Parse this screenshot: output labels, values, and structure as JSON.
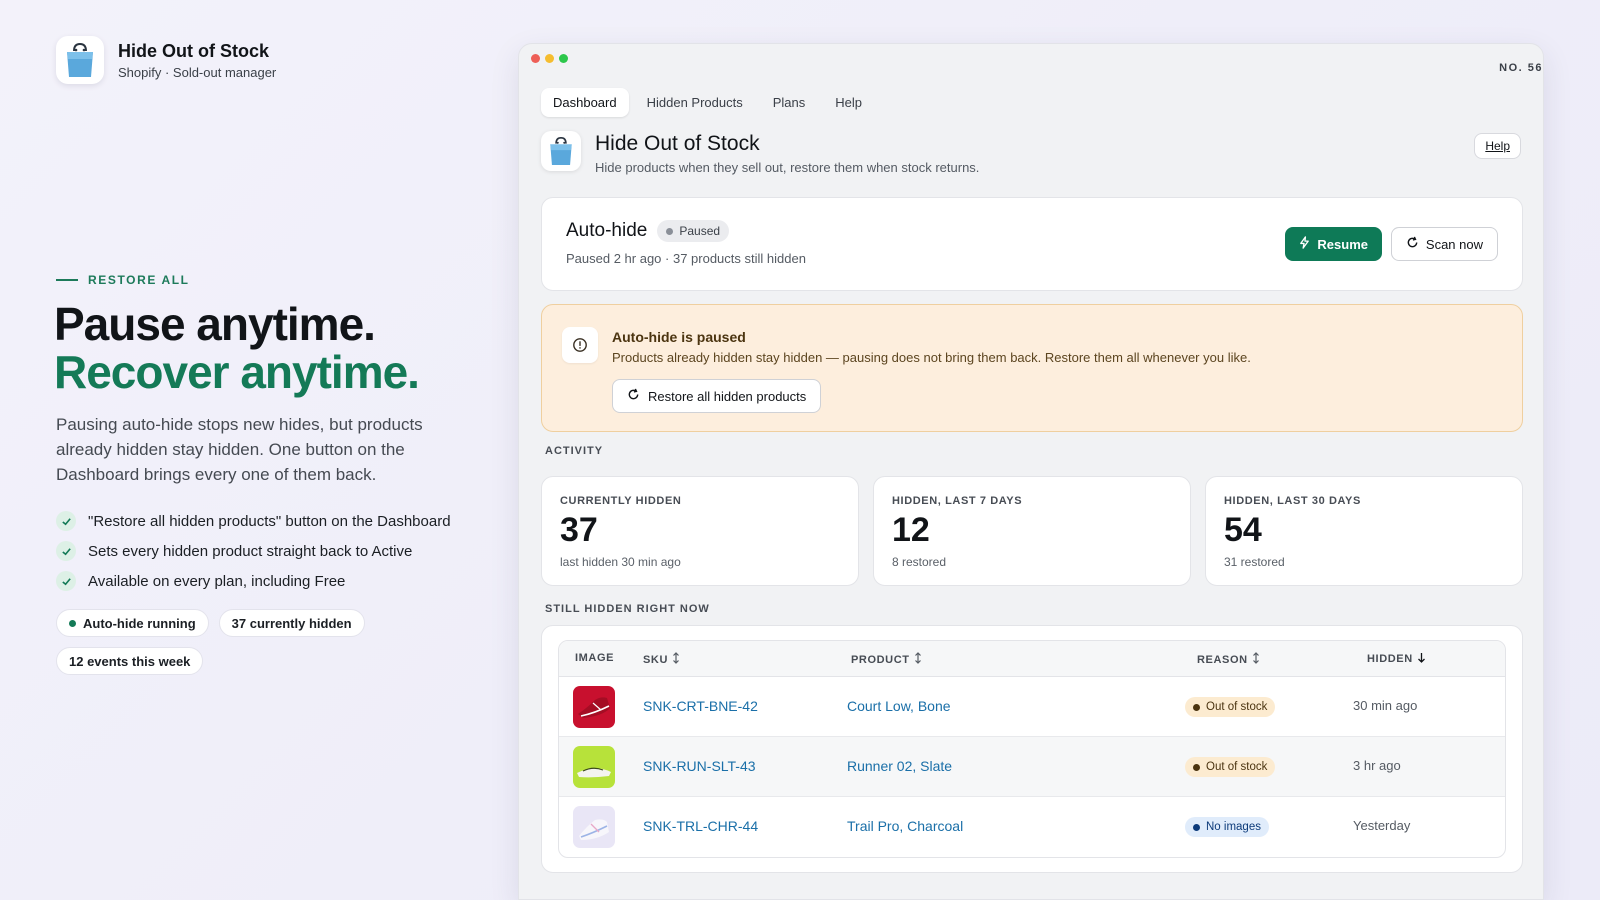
{
  "brand": {
    "title": "Hide Out of Stock",
    "subtitle": "Shopify · Sold-out manager"
  },
  "hero": {
    "eyebrow": "RESTORE ALL",
    "line1": "Pause anytime.",
    "line2": "Recover anytime.",
    "lead": "Pausing auto-hide stops new hides, but products already hidden stay hidden. One button on the Dashboard brings every one of them back.",
    "checks": [
      "\"Restore all hidden products\" button on the Dashboard",
      "Sets every hidden product straight back to Active",
      "Available on every plan, including Free"
    ],
    "pills": [
      "Auto-hide running",
      "37 currently hidden",
      "12 events this week"
    ]
  },
  "window": {
    "serial": "NO. 56",
    "tabs": [
      "Dashboard",
      "Hidden Products",
      "Plans",
      "Help"
    ],
    "app": {
      "title": "Hide Out of Stock",
      "subtitle": "Hide products when they sell out, restore them when stock returns.",
      "help": "Help"
    },
    "autohide": {
      "title": "Auto-hide",
      "status": "Paused",
      "subtitle": "Paused 2 hr ago · 37 products still hidden",
      "resume_label": "Resume",
      "scan_label": "Scan now"
    },
    "banner": {
      "title": "Auto-hide is paused",
      "text": "Products already hidden stay hidden — pausing does not bring them back. Restore them all whenever you like.",
      "button": "Restore all hidden products"
    },
    "activity_label": "ACTIVITY",
    "stats": [
      {
        "label": "CURRENTLY HIDDEN",
        "value": "37",
        "note": "last hidden 30 min ago"
      },
      {
        "label": "HIDDEN, LAST 7 DAYS",
        "value": "12",
        "note": "8 restored"
      },
      {
        "label": "HIDDEN, LAST 30 DAYS",
        "value": "54",
        "note": "31 restored"
      }
    ],
    "table_label": "STILL HIDDEN RIGHT NOW",
    "table": {
      "headers": [
        "IMAGE",
        "SKU",
        "PRODUCT",
        "REASON",
        "HIDDEN"
      ],
      "rows": [
        {
          "sku": "SNK-CRT-BNE-42",
          "product": "Court Low, Bone",
          "reason": "Out of stock",
          "hidden": "30 min ago"
        },
        {
          "sku": "SNK-RUN-SLT-43",
          "product": "Runner 02, Slate",
          "reason": "Out of stock",
          "hidden": "3 hr ago"
        },
        {
          "sku": "SNK-TRL-CHR-44",
          "product": "Trail Pro, Charcoal",
          "reason": "No images",
          "hidden": "Yesterday"
        }
      ]
    }
  },
  "colors": {
    "accent": "#147a57",
    "button_green": "#0e7a57",
    "link": "#1a6fa8",
    "banner_bg": "#fdeedd"
  },
  "icons": [
    "shopping-bag-icon",
    "check-icon",
    "bolt-icon",
    "refresh-icon",
    "info-icon",
    "sort-icon",
    "sort-down-icon"
  ]
}
